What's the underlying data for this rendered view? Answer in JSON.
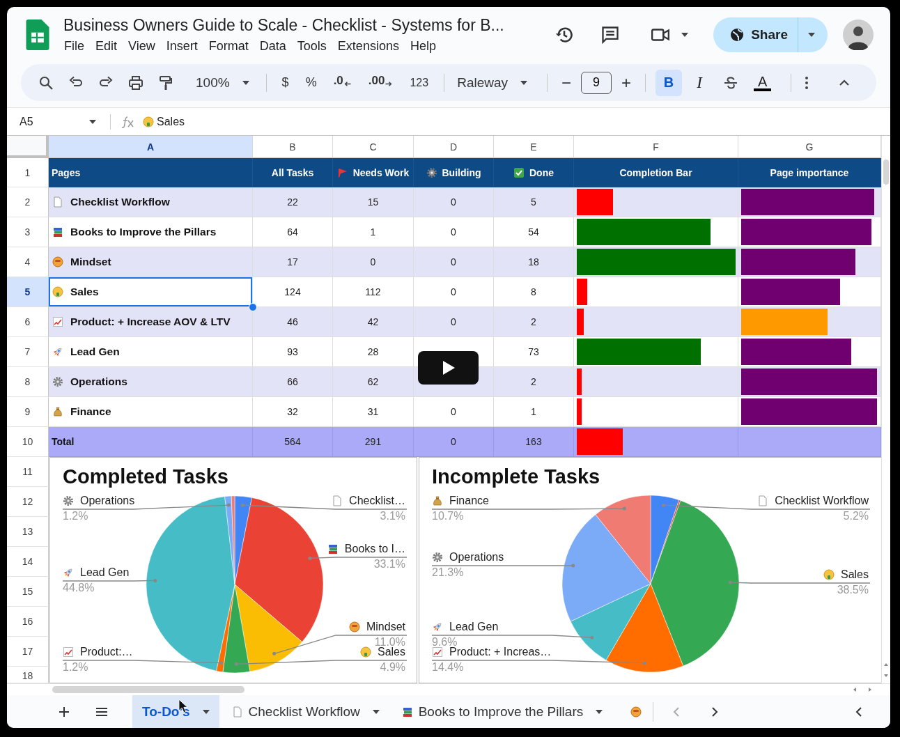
{
  "app": {
    "title": "Business Owners Guide to Scale - Checklist - Systems for B...",
    "menu": [
      "File",
      "Edit",
      "View",
      "Insert",
      "Format",
      "Data",
      "Tools",
      "Extensions",
      "Help"
    ],
    "share_button": "Share"
  },
  "toolbar": {
    "zoom": "100%",
    "currency": "$",
    "percent": "%",
    "decrease_decimal": ".0",
    "increase_decimal": ".00",
    "number_format": "123",
    "font": "Raleway",
    "font_size_decrease": "−",
    "font_size": "9",
    "font_size_increase": "+",
    "bold": {
      "label": "B",
      "on": true
    },
    "italic": {
      "label": "I",
      "on": false
    },
    "text_color": "A"
  },
  "formula_bar": {
    "cell_ref": "A5",
    "formula": "Sales"
  },
  "grid": {
    "columns": [
      {
        "label": "A",
        "selected": true
      },
      {
        "label": "B",
        "selected": false
      },
      {
        "label": "C",
        "selected": false
      },
      {
        "label": "D",
        "selected": false
      },
      {
        "label": "E",
        "selected": false
      },
      {
        "label": "F",
        "selected": false
      },
      {
        "label": "G",
        "selected": false
      }
    ],
    "row_numbers": [
      {
        "label": "1",
        "selected": false
      },
      {
        "label": "2",
        "selected": false
      },
      {
        "label": "3",
        "selected": false
      },
      {
        "label": "4",
        "selected": false
      },
      {
        "label": "5",
        "selected": true
      },
      {
        "label": "6",
        "selected": false
      },
      {
        "label": "7",
        "selected": false
      },
      {
        "label": "8",
        "selected": false
      },
      {
        "label": "9",
        "selected": false
      },
      {
        "label": "10",
        "selected": false
      },
      {
        "label": "11",
        "selected": false
      },
      {
        "label": "12",
        "selected": false
      },
      {
        "label": "13",
        "selected": false
      },
      {
        "label": "14",
        "selected": false
      },
      {
        "label": "15",
        "selected": false
      },
      {
        "label": "16",
        "selected": false
      },
      {
        "label": "17",
        "selected": false
      },
      {
        "label": "18",
        "selected": false
      }
    ],
    "header": [
      "Pages",
      "All Tasks",
      "Needs Work",
      "Building",
      "Done",
      "Completion Bar",
      "Page importance"
    ],
    "rows": [
      {
        "page": "Checklist Workflow",
        "all_tasks": "22",
        "needs_work": "15",
        "building": "0",
        "done": "5",
        "selected": false,
        "completion": {
          "level": 0.23,
          "color": "#ff0000"
        },
        "importance": {
          "level": 0.97,
          "color": "#700070"
        }
      },
      {
        "page": "Books to Improve the Pillars",
        "all_tasks": "64",
        "needs_work": "1",
        "building": "0",
        "done": "54",
        "selected": false,
        "completion": {
          "level": 0.84,
          "color": "#007000"
        },
        "importance": {
          "level": 0.95,
          "color": "#700070"
        }
      },
      {
        "page": "Mindset",
        "all_tasks": "17",
        "needs_work": "0",
        "building": "0",
        "done": "18",
        "selected": false,
        "completion": {
          "level": 1,
          "color": "#007000"
        },
        "importance": {
          "level": 0.83,
          "color": "#700070"
        }
      },
      {
        "page": "Sales",
        "all_tasks": "124",
        "needs_work": "112",
        "building": "0",
        "done": "8",
        "selected": true,
        "completion": {
          "level": 0.065,
          "color": "#ff0000"
        },
        "importance": {
          "level": 0.72,
          "color": "#700070"
        }
      },
      {
        "page": "Product: + Increase AOV & LTV",
        "all_tasks": "46",
        "needs_work": "42",
        "building": "0",
        "done": "2",
        "selected": false,
        "completion": {
          "level": 0.043,
          "color": "#ff0000"
        },
        "importance": {
          "level": 0.63,
          "color": "#ff9900"
        }
      },
      {
        "page": "Lead Gen",
        "all_tasks": "93",
        "needs_work": "28",
        "done": "73",
        "selected": false,
        "completion": {
          "level": 0.78,
          "color": "#007000"
        },
        "importance": {
          "level": 0.8,
          "color": "#700070"
        }
      },
      {
        "page": "Operations",
        "all_tasks": "66",
        "needs_work": "62",
        "done": "2",
        "selected": false,
        "completion": {
          "level": 0.03,
          "color": "#ff0000"
        },
        "importance": {
          "level": 0.99,
          "color": "#700070"
        }
      },
      {
        "page": "Finance",
        "all_tasks": "32",
        "needs_work": "31",
        "building": "0",
        "done": "1",
        "selected": false,
        "completion": {
          "level": 0.03,
          "color": "#ff0000"
        },
        "importance": {
          "level": 0.99,
          "color": "#700070"
        }
      }
    ],
    "total": {
      "label": "Total",
      "all_tasks": "564",
      "needs_work": "291",
      "building": "0",
      "done": "163",
      "completion": {
        "level": 0.29,
        "color": "#ff0000"
      }
    }
  },
  "charts": [
    {
      "chart_data": {
        "type": "pie",
        "title": "Completed Tasks",
        "values": [
          3.1,
          33.1,
          11.0,
          4.9,
          1.2,
          44.8,
          1.2,
          0.6
        ]
      },
      "callouts": [
        {
          "label": "Operations",
          "value": "1.2%"
        },
        {
          "label": "Checklist…",
          "value": "3.1%"
        },
        {
          "label": "Books to I…",
          "value": "33.1%"
        },
        {
          "label": "Lead Gen",
          "value": "44.8%"
        },
        {
          "label": "Mindset",
          "value": "11.0%"
        },
        {
          "label": "Product:…",
          "value": "1.2%"
        },
        {
          "label": "Sales",
          "value": "4.9%"
        }
      ]
    },
    {
      "chart_data": {
        "type": "pie",
        "title": "Incomplete Tasks",
        "values": [
          5.2,
          0.3,
          0,
          38.5,
          14.4,
          9.6,
          21.3,
          10.7
        ]
      },
      "callouts": [
        {
          "label": "Finance",
          "value": "10.7%"
        },
        {
          "label": "Checklist Workflow",
          "value": "5.2%"
        },
        {
          "label": "Operations",
          "value": "21.3%"
        },
        {
          "label": "Sales",
          "value": "38.5%"
        },
        {
          "label": "Lead Gen",
          "value": "9.6%"
        },
        {
          "label": "Product: + Increas…",
          "value": "14.4%"
        }
      ]
    }
  ],
  "sheet_tabs": [
    {
      "label": "To-Do's",
      "selected": true
    },
    {
      "label": "Checklist Workflow",
      "selected": false
    },
    {
      "label": "Books to Improve the Pillars",
      "selected": false
    },
    {
      "selected": false
    }
  ]
}
